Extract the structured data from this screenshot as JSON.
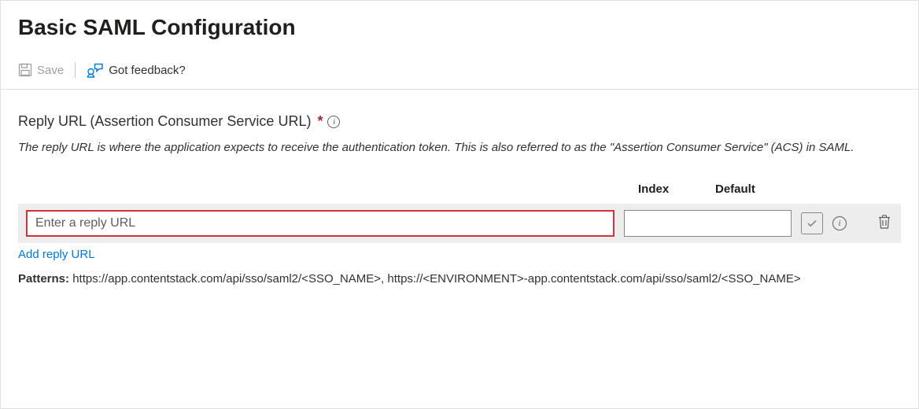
{
  "page_title": "Basic SAML Configuration",
  "toolbar": {
    "save_label": "Save",
    "feedback_label": "Got feedback?"
  },
  "reply_url": {
    "label": "Reply URL (Assertion Consumer Service URL)",
    "description": "The reply URL is where the application expects to receive the authentication token. This is also referred to as the \"Assertion Consumer Service\" (ACS) in SAML.",
    "headers": {
      "index": "Index",
      "default": "Default"
    },
    "placeholder": "Enter a reply URL",
    "index_value": "",
    "add_link": "Add reply URL",
    "patterns_label": "Patterns:",
    "patterns_text": "https://app.contentstack.com/api/sso/saml2/<SSO_NAME>, https://<ENVIRONMENT>-app.contentstack.com/api/sso/saml2/<SSO_NAME>"
  }
}
